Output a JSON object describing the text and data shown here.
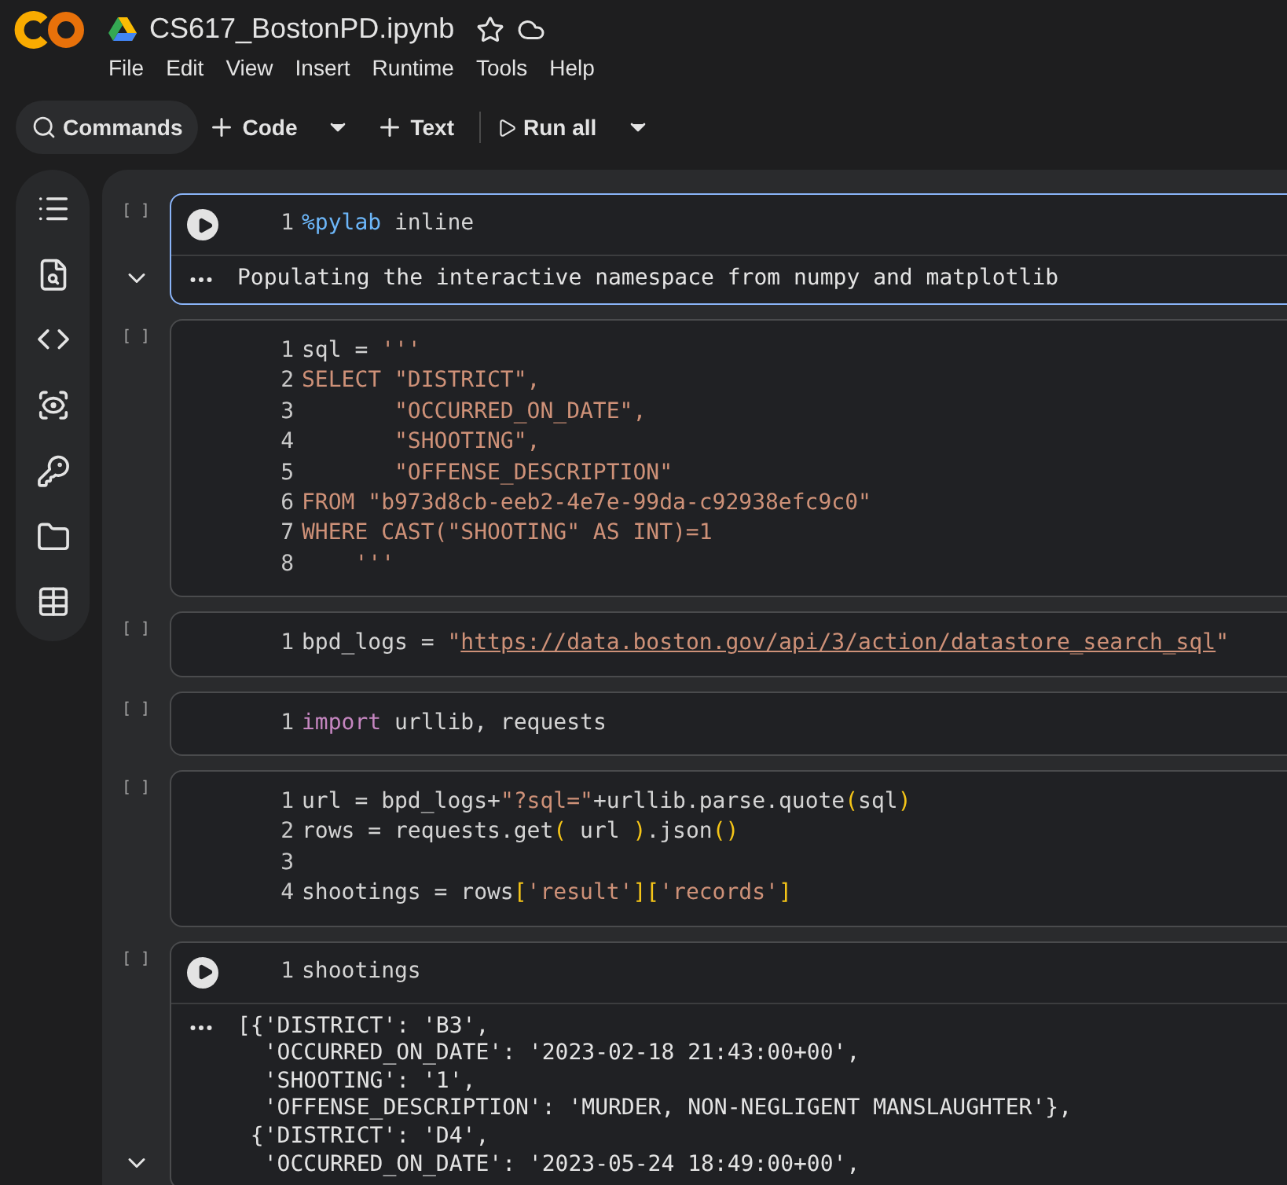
{
  "notebook": {
    "title": "CS617_BostonPD.ipynb",
    "starred": false
  },
  "menu": [
    "File",
    "Edit",
    "View",
    "Insert",
    "Runtime",
    "Tools",
    "Help"
  ],
  "toolbar": [
    {
      "kind": "search",
      "label": "Commands",
      "dropdown": false
    },
    {
      "kind": "add",
      "label": "Code",
      "dropdown": true
    },
    {
      "kind": "add",
      "label": "Text",
      "dropdown": false
    },
    {
      "kind": "run",
      "label": "Run all",
      "dropdown": true
    }
  ],
  "cells": [
    {
      "exec": "[ ]",
      "selected": true,
      "run_button": true,
      "lines": [
        {
          "n": "1",
          "tokens": [
            {
              "kind": "magic",
              "text": "%pylab"
            },
            {
              "kind": "plain",
              "text": " inline"
            }
          ]
        }
      ],
      "output": [
        "Populating the interactive namespace from numpy and matplotlib"
      ]
    },
    {
      "exec": "[ ]",
      "selected": false,
      "run_button": false,
      "lines": [
        {
          "n": "1",
          "tokens": [
            {
              "kind": "plain",
              "text": "sql = "
            },
            {
              "kind": "str",
              "text": "'''"
            }
          ]
        },
        {
          "n": "2",
          "tokens": [
            {
              "kind": "str",
              "text": "SELECT \"DISTRICT\","
            }
          ]
        },
        {
          "n": "3",
          "tokens": [
            {
              "kind": "str",
              "text": "       \"OCCURRED_ON_DATE\","
            }
          ]
        },
        {
          "n": "4",
          "tokens": [
            {
              "kind": "str",
              "text": "       \"SHOOTING\","
            }
          ]
        },
        {
          "n": "5",
          "tokens": [
            {
              "kind": "str",
              "text": "       \"OFFENSE_DESCRIPTION\""
            }
          ]
        },
        {
          "n": "6",
          "tokens": [
            {
              "kind": "str",
              "text": "FROM \"b973d8cb-eeb2-4e7e-99da-c92938efc9c0\""
            }
          ]
        },
        {
          "n": "7",
          "tokens": [
            {
              "kind": "str",
              "text": "WHERE CAST(\"SHOOTING\" AS INT)=1"
            }
          ]
        },
        {
          "n": "8",
          "tokens": [
            {
              "kind": "str",
              "text": "    '''"
            }
          ]
        }
      ]
    },
    {
      "exec": "[ ]",
      "selected": false,
      "run_button": false,
      "lines": [
        {
          "n": "1",
          "tokens": [
            {
              "kind": "plain",
              "text": "bpd_logs = "
            },
            {
              "kind": "str",
              "text": "\""
            },
            {
              "kind": "link",
              "text": "https://data.boston.gov/api/3/action/datastore_search_sql"
            },
            {
              "kind": "str",
              "text": "\""
            }
          ]
        }
      ]
    },
    {
      "exec": "[ ]",
      "selected": false,
      "run_button": false,
      "lines": [
        {
          "n": "1",
          "tokens": [
            {
              "kind": "kw",
              "text": "import"
            },
            {
              "kind": "plain",
              "text": " urllib, requests"
            }
          ]
        }
      ]
    },
    {
      "exec": "[ ]",
      "selected": false,
      "run_button": false,
      "lines": [
        {
          "n": "1",
          "tokens": [
            {
              "kind": "plain",
              "text": "url = bpd_logs+"
            },
            {
              "kind": "str",
              "text": "\"?sql=\""
            },
            {
              "kind": "plain",
              "text": "+urllib.parse.quote"
            },
            {
              "kind": "bracket",
              "text": "("
            },
            {
              "kind": "plain",
              "text": "sql"
            },
            {
              "kind": "bracket",
              "text": ")"
            }
          ]
        },
        {
          "n": "2",
          "tokens": [
            {
              "kind": "plain",
              "text": "rows = requests.get"
            },
            {
              "kind": "bracket",
              "text": "("
            },
            {
              "kind": "plain",
              "text": " url "
            },
            {
              "kind": "bracket",
              "text": ")"
            },
            {
              "kind": "plain",
              "text": ".json"
            },
            {
              "kind": "bracket",
              "text": "()"
            }
          ]
        },
        {
          "n": "3"
        },
        {
          "n": "4",
          "tokens": [
            {
              "kind": "plain",
              "text": "shootings = rows"
            },
            {
              "kind": "bracket",
              "text": "["
            },
            {
              "kind": "str",
              "text": "'result'"
            },
            {
              "kind": "bracket",
              "text": "]["
            },
            {
              "kind": "str",
              "text": "'records'"
            },
            {
              "kind": "bracket",
              "text": "]"
            }
          ]
        }
      ]
    },
    {
      "exec": "[ ]",
      "selected": false,
      "run_button": true,
      "lines": [
        {
          "n": "1",
          "tokens": [
            {
              "kind": "plain",
              "text": "shootings"
            }
          ]
        }
      ],
      "output": [
        "[{'DISTRICT': 'B3',",
        "  'OCCURRED_ON_DATE': '2023-02-18 21:43:00+00',",
        "  'SHOOTING': '1',",
        "  'OFFENSE_DESCRIPTION': 'MURDER, NON-NEGLIGENT MANSLAUGHTER'},",
        " {'DISTRICT': 'D4',",
        "  'OCCURRED_ON_DATE': '2023-05-24 18:49:00+00',"
      ]
    }
  ]
}
